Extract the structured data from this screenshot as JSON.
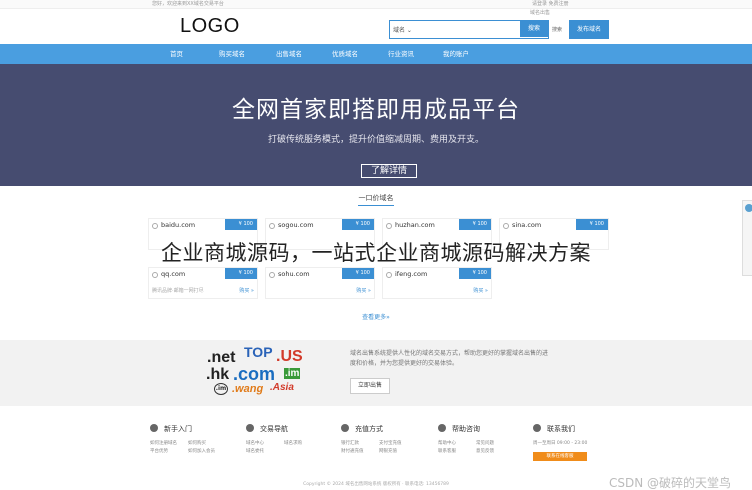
{
  "topbar": {
    "left": "您好，欢迎来到XX域名交易平台",
    "right": "请登录  免费注册"
  },
  "header": {
    "logo": "LOGO",
    "search": {
      "select": "域名",
      "button": "搜索"
    },
    "link_small": "域名出售",
    "link": "搜索",
    "button": "发布域名"
  },
  "nav": [
    "首页",
    "购买域名",
    "出售域名",
    "优质域名",
    "行业资讯",
    "我的账户"
  ],
  "hero": {
    "title": "全网首家即搭即用成品平台",
    "subtitle": "打破传统服务模式，提升价值缩减周期、费用及开支。",
    "button": "了解详情"
  },
  "section": {
    "title": "一口价域名",
    "see_more": "查看更多»"
  },
  "domains_row1": [
    {
      "name": "baidu.com",
      "price": "¥ 100"
    },
    {
      "name": "sogou.com",
      "price": "¥ 100"
    },
    {
      "name": "huzhan.com",
      "price": "¥ 100"
    },
    {
      "name": "sina.com",
      "price": "¥ 100"
    }
  ],
  "domains_row2": [
    {
      "name": "qq.com",
      "price": "¥ 100",
      "desc": "腾讯品牌·邮箱一网打尽",
      "buy": "购买 »"
    },
    {
      "name": "sohu.com",
      "price": "¥ 100",
      "desc": "",
      "buy": "购买 »"
    },
    {
      "name": "ifeng.com",
      "price": "¥ 100",
      "desc": "",
      "buy": "购买 »"
    }
  ],
  "overlay_title": "企业商城源码，一站式企业商城源码解决方案",
  "promo": {
    "badges": {
      "net": ".net",
      "top": "TOP",
      "us": ".US",
      "hk": ".hk",
      "com": ".com",
      "im": ".im",
      "wang": ".wang",
      "asia": ".Asia",
      "circle": ".im"
    },
    "text": "域名出售系统提供人性化的域名交易方式，帮助您更好的掌握域名出售的进度和价格，并为您提供更好的交易体验。",
    "button": "立即出售"
  },
  "footer_cols": [
    {
      "title": "新手入门",
      "links": [
        "如何注册域名",
        "如何购买",
        "平台优势",
        "如何加入会员"
      ]
    },
    {
      "title": "交易导航",
      "links": [
        "域名中心",
        "域名求购",
        "域名委托"
      ]
    },
    {
      "title": "充值方式",
      "links": [
        "银行汇款",
        "支付宝充值",
        "财付通充值",
        "网银充值"
      ]
    },
    {
      "title": "帮助咨询",
      "links": [
        "帮助中心",
        "常见问题",
        "联系客服",
        "意见反馈"
      ]
    },
    {
      "title": "联系我们",
      "links": [
        "周一至周日 09:00 - 23:00"
      ]
    }
  ],
  "contact_button": "联系在线客服",
  "copyright": "Copyright © 2024 域名出售网站系统 版权所有 · 联系电话: 13456789",
  "watermark": "CSDN @破碎的天堂鸟"
}
